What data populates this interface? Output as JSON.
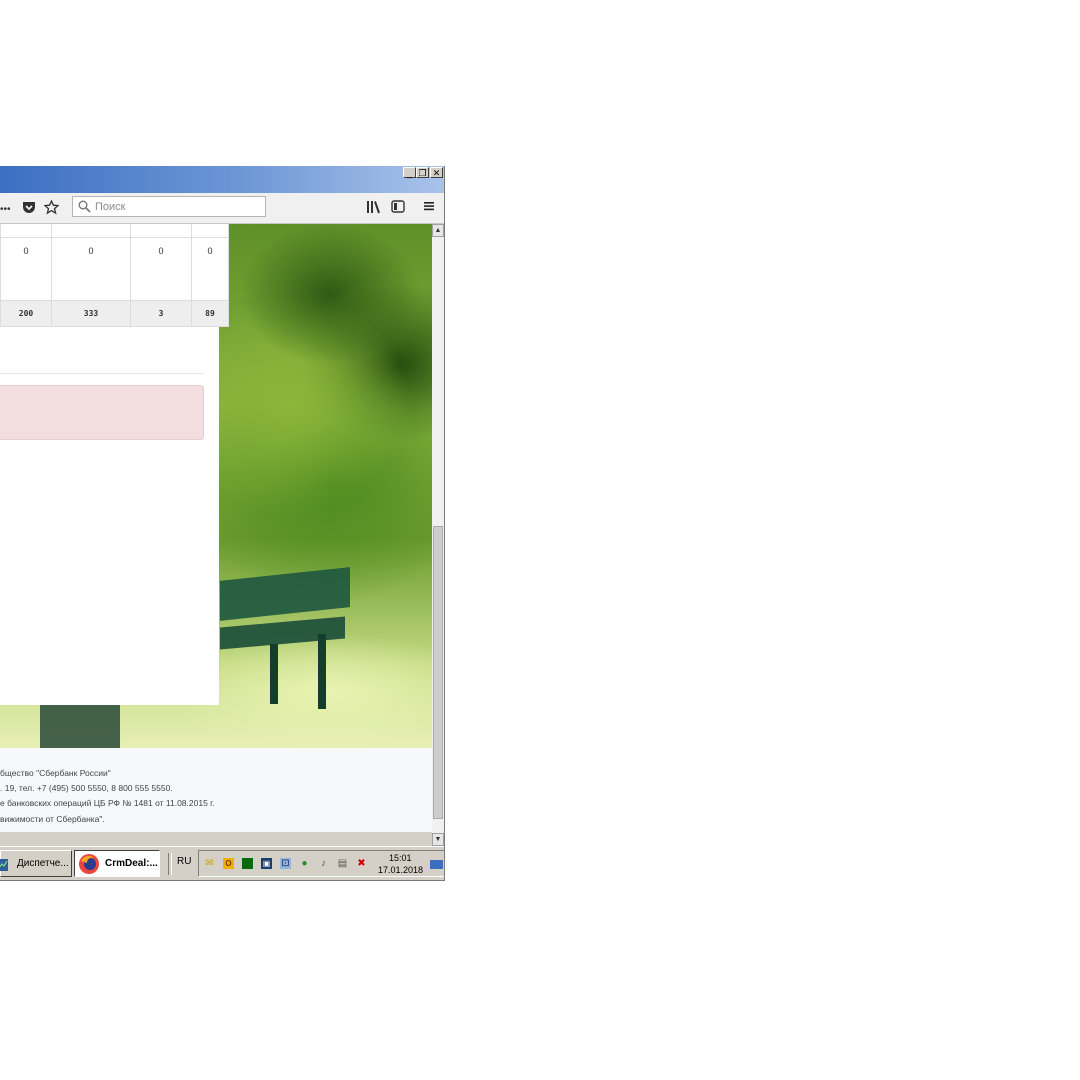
{
  "window": {
    "controls": [
      "_",
      "❐",
      "✕"
    ]
  },
  "toolbar": {
    "more_label": "•••",
    "search_placeholder": "Поиск"
  },
  "table": {
    "zero_row": [
      "0",
      "0",
      "0",
      "0"
    ],
    "total_row": [
      "200",
      "333",
      "3",
      "89"
    ]
  },
  "footer": {
    "lines": [
      "бщество \"Сбербанк России\"",
      ". 19, тел. +7 (495) 500 5550, 8 800 555 5550.",
      "е банковских операций ЦБ РФ № 1481 от 11.08.2015 г.",
      "вижимости от Сбербанка\"."
    ]
  },
  "taskbar": {
    "task1_label": "Диспетче...",
    "task2_label": "CrmDeal:...",
    "language": "RU",
    "time": "15:01",
    "date": "17.01.2018"
  },
  "colors": {
    "alert_bg": "#f2dede",
    "titlebar": "#3c6fc2"
  }
}
